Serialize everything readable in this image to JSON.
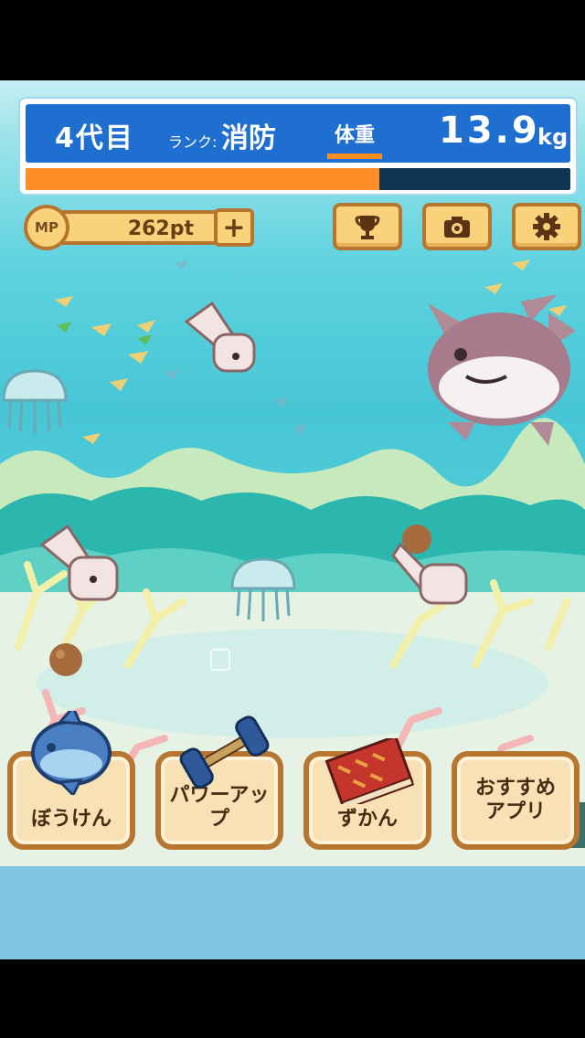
{
  "hud": {
    "generation": "4代目",
    "rank_label": "ランク:",
    "rank_value": "消防",
    "weight_tab": "体重",
    "weight_value": "13.9",
    "weight_unit": "kg",
    "growth_progress": 0.65
  },
  "points": {
    "mp_label": "MP",
    "value": "262pt",
    "add_label": "+"
  },
  "toolbar": {
    "icons": [
      "trophy-icon",
      "camera-icon",
      "gear-icon"
    ]
  },
  "menu": {
    "items": [
      {
        "label": "ぼうけん"
      },
      {
        "label": "パワーアップ"
      },
      {
        "label": "ずかん"
      },
      {
        "label": "おすすめ\nアプリ"
      }
    ]
  },
  "colors": {
    "hud_blue": "#1f6fd0",
    "progress_orange": "#ff8e25",
    "button_bg": "#fbd27c",
    "button_border": "#b77630"
  }
}
